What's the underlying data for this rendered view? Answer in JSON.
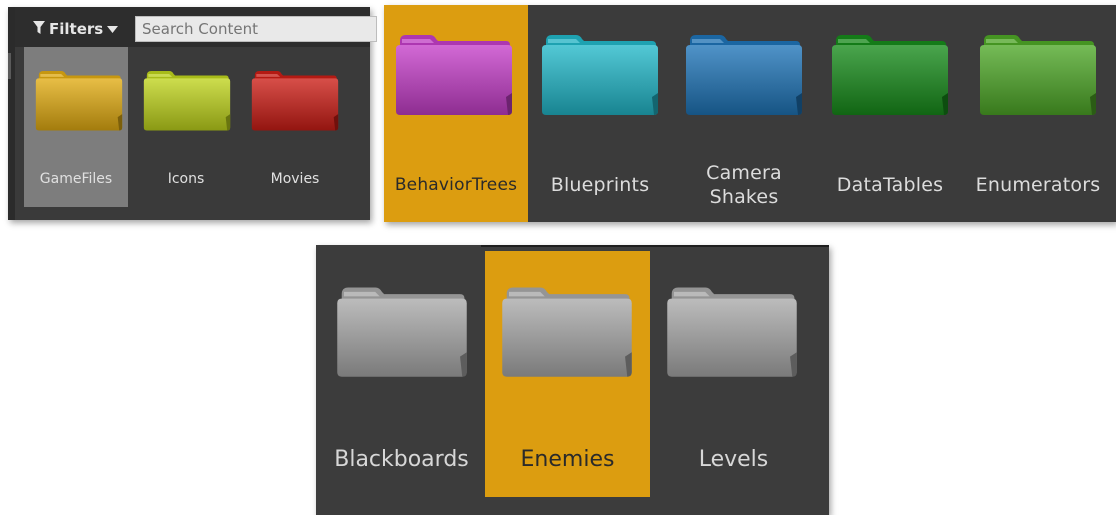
{
  "content_browser_toolbar": {
    "filters_label": "Filters",
    "filter_icon": "funnel-icon",
    "dropdown_icon": "caret-down-icon",
    "search_placeholder": "Search Content"
  },
  "root_folders": [
    {
      "label": "GameFiles",
      "color": "#e2ac12",
      "selected": true
    },
    {
      "label": "Icons",
      "color": "#bfd41c",
      "selected": false
    },
    {
      "label": "Movies",
      "color": "#cc1d16",
      "selected": false
    }
  ],
  "colored_folders": [
    {
      "label": "BehaviorTrees",
      "color": "#c53fc9",
      "selected": true
    },
    {
      "label": "Blueprints",
      "color": "#22b8c9",
      "selected": false
    },
    {
      "label": "Camera Shakes",
      "color": "#1f74b8",
      "selected": false
    },
    {
      "label": "DataTables",
      "color": "#178c1b",
      "selected": false
    },
    {
      "label": "Enumerators",
      "color": "#4ea827",
      "selected": false
    }
  ],
  "gray_folders": [
    {
      "label": "Blackboards",
      "color": "#a9a9a9",
      "selected": false
    },
    {
      "label": "Enemies",
      "color": "#a9a9a9",
      "selected": true
    },
    {
      "label": "Levels",
      "color": "#a9a9a9",
      "selected": false
    }
  ],
  "colors": {
    "selection_gold": "#dc9d10",
    "selection_gray": "#7d7d7d",
    "panel_bg": "#3c3c3c"
  }
}
